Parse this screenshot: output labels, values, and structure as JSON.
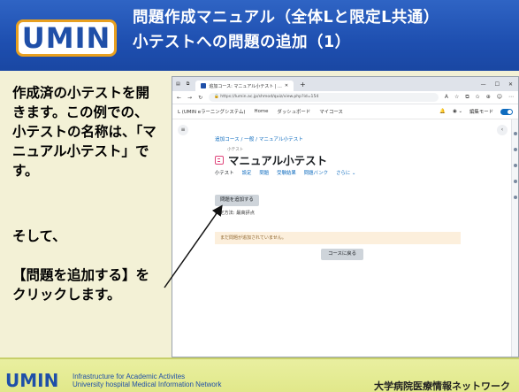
{
  "header": {
    "logo": "UMIN",
    "title_line1": "問題作成マニュアル（全体Lと限定L共通）",
    "title_line2": "小テストへの問題の追加（1）"
  },
  "description": {
    "p1": "作成済の小テストを開きます。この例での、小テストの名称は、「マニュアル小テスト」です。",
    "p2_line1": "そして、",
    "p2_line2": "【問題を追加する】をクリックします。"
  },
  "screenshot": {
    "tab_label": "追加コース: マニュアル小テスト | ...",
    "url": "https://lumin.ac.jp/shmod/quiz/view.php?id=154",
    "site_name": "L (UMIN eラーニングシステム)",
    "nav_items": [
      "Home",
      "ダッシュボード",
      "マイコース"
    ],
    "edit_mode_label": "編集モード",
    "breadcrumb": "追加コース / 一般 / マニュアル小テスト",
    "activity_type": "小テスト",
    "quiz_title": "マニュアル小テスト",
    "secondary_nav": [
      "小テスト",
      "設定",
      "問題",
      "受験結果",
      "問題バンク",
      "さらに ⌄"
    ],
    "add_question_button": "問題を追加する",
    "grading_method": "評定方法: 最高評点",
    "no_questions_notice": "まだ問題が追加されていません。",
    "back_to_course_button": "コースに戻る"
  },
  "footer": {
    "logo": "UMIN",
    "subtitle_line1": "Infrastructure for Academic Activites",
    "subtitle_line2": "University hospital Medical Information Network",
    "right_text": "大学病院医療情報ネットワーク"
  },
  "colors": {
    "header_blue": "#1e4fb0",
    "background": "#f3f1d6",
    "footer_yellow": "#e5eb95",
    "moodle_link": "#0f6cbf",
    "notice_bg": "#fcefdc"
  }
}
